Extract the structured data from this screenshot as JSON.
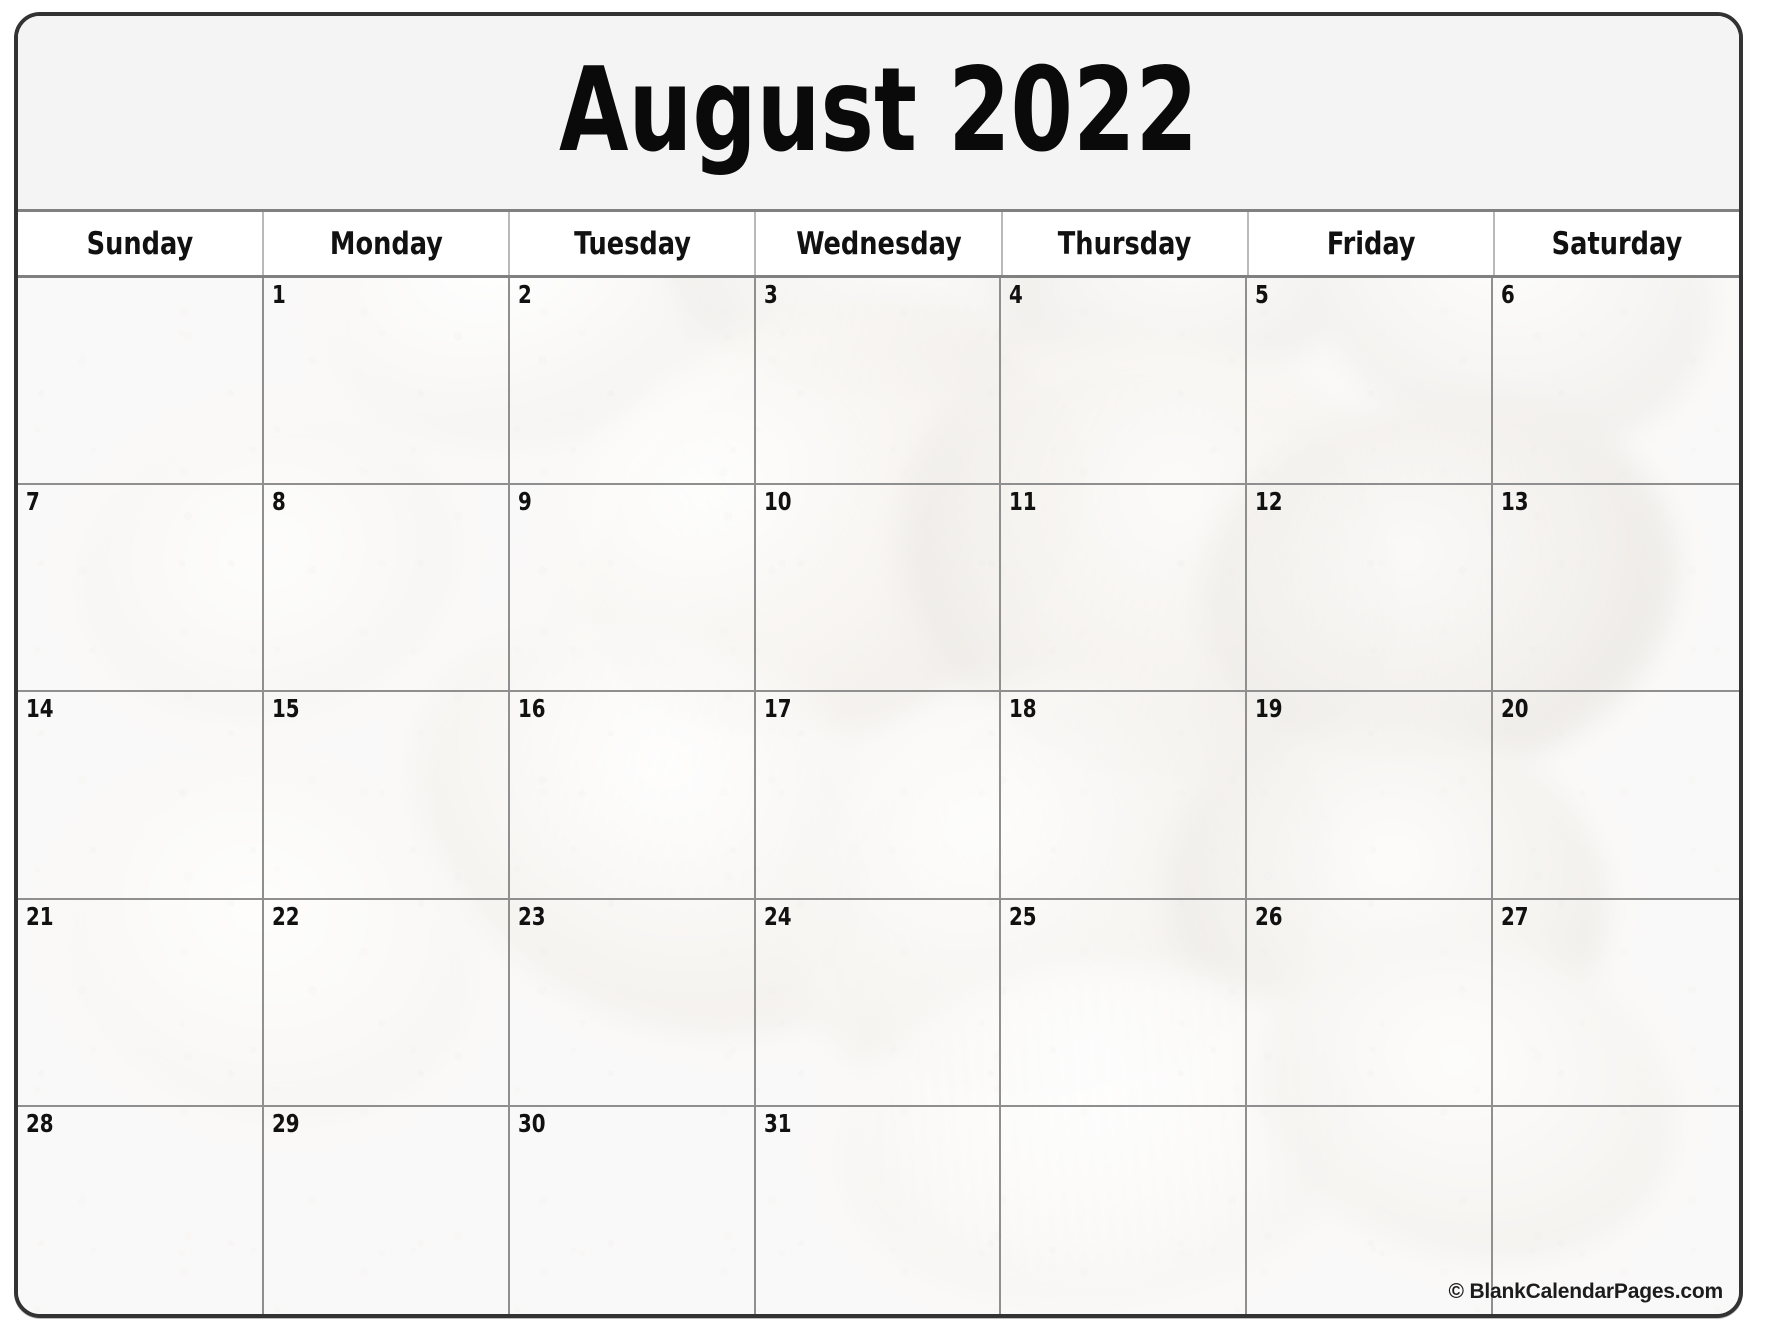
{
  "calendar": {
    "title": "August 2022",
    "month": "August",
    "year": "2022",
    "weekdays": [
      {
        "label": "Sunday"
      },
      {
        "label": "Monday"
      },
      {
        "label": "Tuesday"
      },
      {
        "label": "Wednesday"
      },
      {
        "label": "Thursday"
      },
      {
        "label": "Friday"
      },
      {
        "label": "Saturday"
      }
    ],
    "weeks": [
      [
        "",
        "1",
        "2",
        "3",
        "4",
        "5",
        "6"
      ],
      [
        "7",
        "8",
        "9",
        "10",
        "11",
        "12",
        "13"
      ],
      [
        "14",
        "15",
        "16",
        "17",
        "18",
        "19",
        "20"
      ],
      [
        "21",
        "22",
        "23",
        "24",
        "25",
        "26",
        "27"
      ],
      [
        "28",
        "29",
        "30",
        "31",
        "",
        "",
        ""
      ]
    ],
    "watermark": "© BlankCalendarPages.com",
    "background_theme": "seashells-on-sand-faded-photo",
    "colors": {
      "frame_border": "#333333",
      "title_background": "#f4f4f4",
      "weekday_background": "#ffffff",
      "grid_line": "#8f8f8f",
      "header_divider": "#808080",
      "text": "#111111",
      "photo_tint": "#f2f0ee"
    }
  }
}
